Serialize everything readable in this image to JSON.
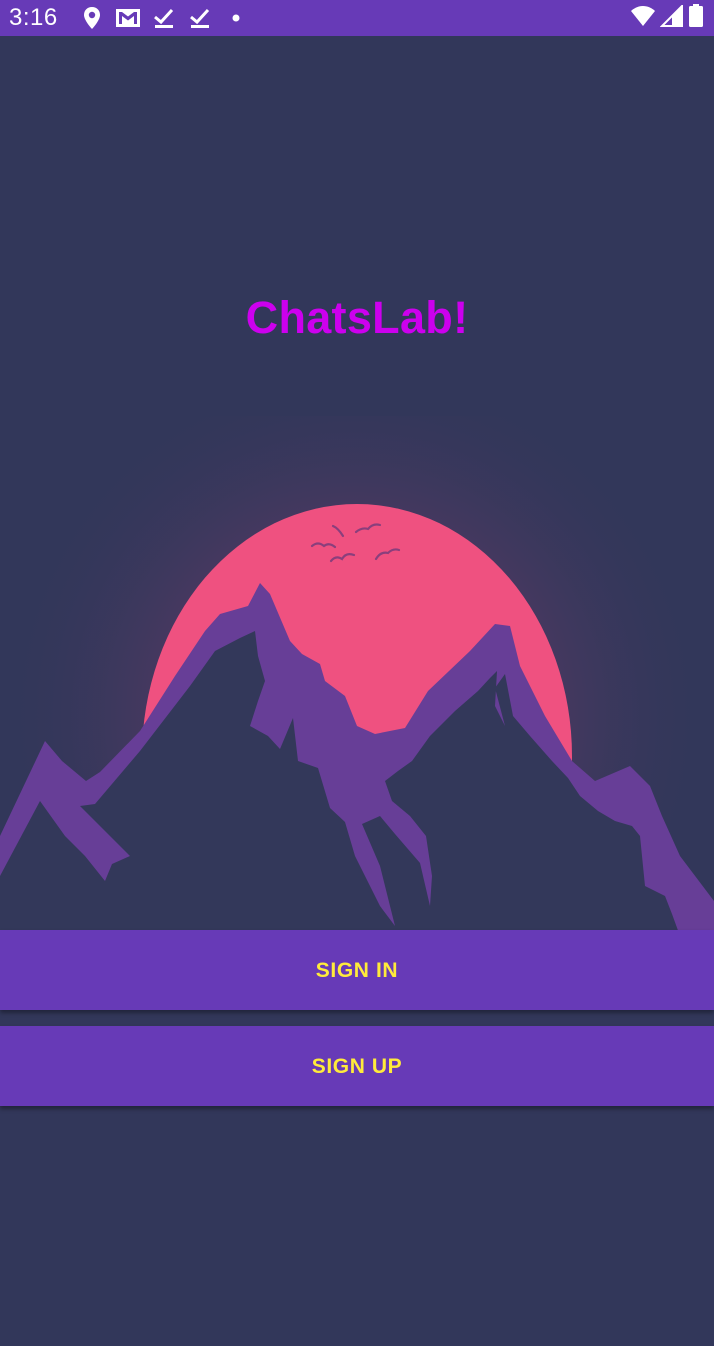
{
  "status_bar": {
    "time": "3:16",
    "left_icons": [
      "location-icon",
      "gmail-icon",
      "check-icon",
      "check-icon",
      "dot-icon"
    ],
    "right_icons": [
      "wifi-icon",
      "signal-icon",
      "battery-icon"
    ]
  },
  "app": {
    "title": "ChatsLab!"
  },
  "hero": {
    "image": "mountain-sunset-illustration",
    "colors": {
      "sky": "#32375a",
      "sun": "#ef5180",
      "mountain_back": "#673e97",
      "mountain_front": "#33385a",
      "glow": "#6a3a6a"
    }
  },
  "buttons": {
    "sign_in": "SIGN IN",
    "sign_up": "SIGN UP"
  },
  "theme": {
    "primary": "#673ab7",
    "background": "#32375a",
    "title_color": "#cc00ee",
    "button_text": "#ffeb3b"
  }
}
